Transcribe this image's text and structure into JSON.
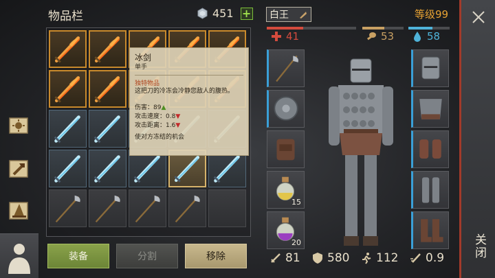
{
  "inventory": {
    "title": "物品栏",
    "currency_value": "451",
    "add_currency_label": "+",
    "slots": [
      {
        "item": "fire-sword",
        "rarity": "legendary"
      },
      {
        "item": "fire-sword",
        "rarity": "legendary"
      },
      {
        "item": "fire-sword",
        "rarity": "legendary"
      },
      {
        "item": "fire-sword",
        "rarity": "legendary"
      },
      {
        "item": "fire-sword",
        "rarity": "legendary"
      },
      {
        "item": "fire-sword",
        "rarity": "legendary"
      },
      {
        "item": "fire-sword",
        "rarity": "legendary"
      },
      {
        "item": "fire-sword",
        "rarity": "legendary"
      },
      {
        "item": "fire-sword",
        "rarity": "legendary"
      },
      {
        "item": "fire-sword",
        "rarity": "legendary"
      },
      {
        "item": "ice-sword",
        "rarity": "rare"
      },
      {
        "item": "ice-sword",
        "rarity": "rare"
      },
      {
        "item": "ice-sword",
        "rarity": "rare"
      },
      {
        "item": "ice-sword",
        "rarity": "rare"
      },
      {
        "item": "ice-sword",
        "rarity": "rare"
      },
      {
        "item": "ice-sword",
        "rarity": "rare"
      },
      {
        "item": "ice-sword",
        "rarity": "rare"
      },
      {
        "item": "ice-sword",
        "rarity": "rare"
      },
      {
        "item": "ice-sword",
        "rarity": "rare",
        "selected": true
      },
      {
        "item": "ice-sword",
        "rarity": "rare"
      },
      {
        "item": "halberd",
        "rarity": "common"
      },
      {
        "item": "halberd",
        "rarity": "common"
      },
      {
        "item": "halberd",
        "rarity": "common"
      },
      {
        "item": "halberd",
        "rarity": "common"
      },
      {
        "item": "",
        "rarity": "empty"
      }
    ]
  },
  "tooltip": {
    "name": "冰剑",
    "type": "单手",
    "rarity": "独特物品",
    "description": "这把刀的冷冻会冷静您敌人的腹热。",
    "stats": [
      {
        "label": "伤害：",
        "value": "89",
        "trend": "▲",
        "trend_dir": "up"
      },
      {
        "label": "攻击速度：",
        "value": "0.8",
        "trend": "▼",
        "trend_dir": "down"
      },
      {
        "label": "攻击距离：",
        "value": "1.6",
        "trend": "▼",
        "trend_dir": "down"
      }
    ],
    "effect": "使对方冻结的机会"
  },
  "buttons": {
    "equip": "装备",
    "split": "分割",
    "remove": "移除"
  },
  "character": {
    "name": "白王",
    "level_label": "等级99",
    "health": "41",
    "food": "53",
    "water": "58",
    "health_fill": 0.41,
    "food_fill": 0.53,
    "water_fill": 0.58,
    "potion_small_qty": "15",
    "potion_large_qty": "20",
    "stats": {
      "attack": "81",
      "armor": "580",
      "speed": "112",
      "attack_speed": "0.9"
    }
  },
  "close": {
    "label": "关闭"
  },
  "colors": {
    "health": "#d44b3d",
    "food": "#c8a063",
    "water": "#4fb3d9",
    "level": "#e7a233"
  }
}
